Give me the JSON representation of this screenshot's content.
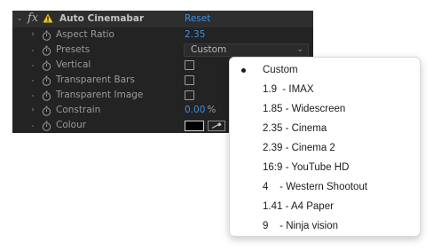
{
  "effect": {
    "name": "Auto Cinemabar",
    "reset_label": "Reset"
  },
  "properties": {
    "aspect_ratio": {
      "label": "Aspect Ratio",
      "value": "2.35"
    },
    "presets": {
      "label": "Presets",
      "value": "Custom"
    },
    "vertical": {
      "label": "Vertical"
    },
    "transparent_bars": {
      "label": "Transparent Bars"
    },
    "transparent_image": {
      "label": "Transparent Image"
    },
    "constrain": {
      "label": "Constrain",
      "value": "0.00",
      "unit": "%"
    },
    "colour": {
      "label": "Colour",
      "swatch": "#000000"
    }
  },
  "dropdown": {
    "selected_index": 0,
    "options": [
      "Custom",
      "1.9  - IMAX",
      "1.85 - Widescreen",
      "2.35 - Cinema",
      "2.39 - Cinema 2",
      "16:9 - YouTube HD",
      "4    - Western Shootout",
      "1.41 - A4 Paper",
      "9    - Ninja vision"
    ]
  },
  "colors": {
    "panel_bg": "#232323",
    "value_blue": "#3d8fe0",
    "warning_yellow": "#f0c419"
  }
}
